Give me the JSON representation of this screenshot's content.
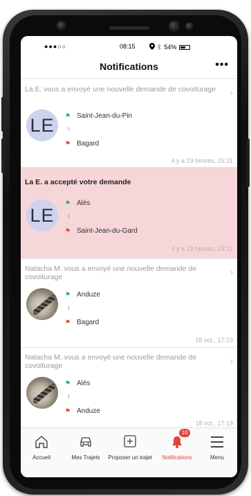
{
  "status_bar": {
    "carrier": "●●●○○",
    "time": "08:15",
    "battery": "54%"
  },
  "header": {
    "title": "Notifications",
    "more": "•••"
  },
  "notifications": [
    {
      "title": "La E. vous a envoyé une nouvelle demande de covoiturage",
      "avatar": "LE",
      "from": "Saint-Jean-du-Pin",
      "to": "Bagard",
      "time": "il y a 19 heures, 15:31",
      "highlighted": false
    },
    {
      "title": "La E. a accepté votre demande",
      "avatar": "LE",
      "from": "Alès",
      "to": "Saint-Jean-du-Gard",
      "time": "il y a 19 heures, 15:12",
      "highlighted": true
    },
    {
      "title": "Natacha M. vous a envoyé une nouvelle demande de covoiturage",
      "avatar": "",
      "from": "Anduze",
      "to": "Bagard",
      "time": "18 oct., 17:23",
      "highlighted": false
    },
    {
      "title": "Natacha M. vous a envoyé une nouvelle demande de covoiturage",
      "avatar": "",
      "from": "Alès",
      "to": "Anduze",
      "time": "18 oct., 17:19",
      "highlighted": false
    }
  ],
  "route_separator": "⁝",
  "tabs": [
    {
      "label": "Accueil"
    },
    {
      "label": "Mes Trajets"
    },
    {
      "label": "Proposer un trajet"
    },
    {
      "label": "Notifications",
      "badge": "10"
    },
    {
      "label": "Menu"
    }
  ],
  "colors": {
    "accent": "#e2433b",
    "highlight_row": "#f6d6d8",
    "avatar_bg": "#cdd3ec",
    "start_flag": "#2fae4c",
    "end_flag": "#e2432d"
  },
  "icons": {
    "start": "green-flag-icon",
    "end": "red-flag-icon",
    "chevron": "chevron-right-icon"
  }
}
